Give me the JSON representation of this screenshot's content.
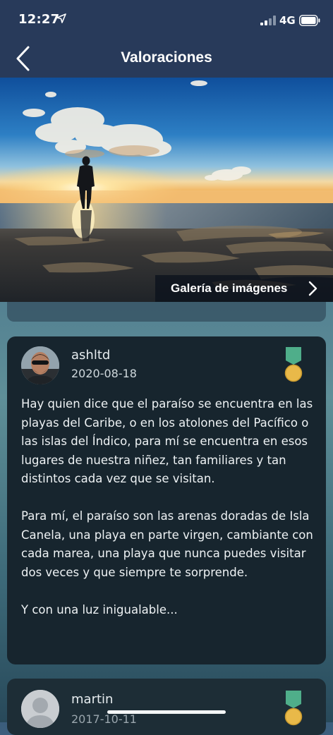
{
  "status_bar": {
    "time": "12:27",
    "network": "4G"
  },
  "nav": {
    "title": "Valoraciones"
  },
  "hero": {
    "gallery_label": "Galería de imágenes"
  },
  "reviews": [
    {
      "username": "ashltd",
      "date": "2020-08-18",
      "paragraphs": [
        "Hay quien dice que el paraíso se encuentra en las playas del Caribe, o en los atolones del Pacífico o las islas del Índico, para mí se encuentra en esos lugares de nuestra niñez, tan familiares y tan distintos cada vez que se visitan.",
        "Para mí, el paraíso son las arenas doradas de Isla Canela, una playa en parte virgen, cambiante con cada marea, una playa que nunca puedes visitar dos veces y que siempre te sorprende.",
        "Y con una luz inigualable..."
      ]
    },
    {
      "username": "martin",
      "date": "2017-10-11"
    }
  ],
  "colors": {
    "nav_bg": "#283a5a",
    "card_bg": "#17252e",
    "medal_ribbon": "#4fae8a",
    "medal_gold": "#e9b949"
  },
  "icons": {
    "back": "chevron-left-icon",
    "gallery": "chevron-right-icon",
    "medal": "medal-icon",
    "location": "location-arrow-icon"
  }
}
